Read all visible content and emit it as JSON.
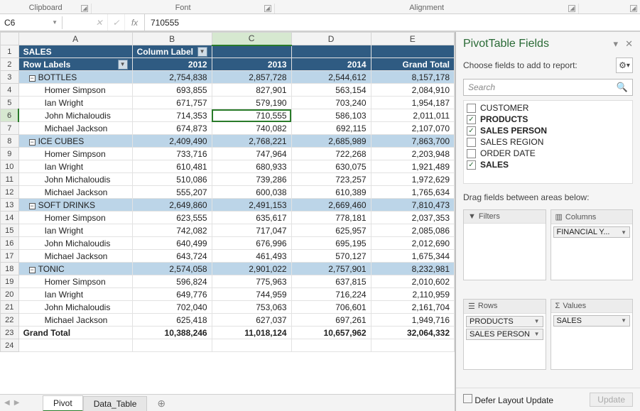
{
  "ribbon": {
    "groups": [
      "Clipboard",
      "Font",
      "Alignment",
      ""
    ]
  },
  "namebox": "C6",
  "formula": "710555",
  "columns": [
    "A",
    "B",
    "C",
    "D",
    "E"
  ],
  "active_col_idx": 2,
  "active_row": 6,
  "pivot": {
    "title_left": "SALES",
    "title_right": "Column Label",
    "row_labels": "Row Labels",
    "years": [
      "2012",
      "2013",
      "2014"
    ],
    "grand_total": "Grand Total"
  },
  "rows": [
    {
      "r": 3,
      "type": "cat",
      "label": "BOTTLES",
      "vals": [
        "2,754,838",
        "2,857,728",
        "2,544,612",
        "8,157,178"
      ]
    },
    {
      "r": 4,
      "type": "d",
      "label": "Homer Simpson",
      "vals": [
        "693,855",
        "827,901",
        "563,154",
        "2,084,910"
      ]
    },
    {
      "r": 5,
      "type": "d",
      "label": "Ian Wright",
      "vals": [
        "671,757",
        "579,190",
        "703,240",
        "1,954,187"
      ]
    },
    {
      "r": 6,
      "type": "d",
      "label": "John Michaloudis",
      "vals": [
        "714,353",
        "710,555",
        "586,103",
        "2,011,011"
      ]
    },
    {
      "r": 7,
      "type": "d",
      "label": "Michael Jackson",
      "vals": [
        "674,873",
        "740,082",
        "692,115",
        "2,107,070"
      ]
    },
    {
      "r": 8,
      "type": "cat",
      "label": "ICE CUBES",
      "vals": [
        "2,409,490",
        "2,768,221",
        "2,685,989",
        "7,863,700"
      ]
    },
    {
      "r": 9,
      "type": "d",
      "label": "Homer Simpson",
      "vals": [
        "733,716",
        "747,964",
        "722,268",
        "2,203,948"
      ]
    },
    {
      "r": 10,
      "type": "d",
      "label": "Ian Wright",
      "vals": [
        "610,481",
        "680,933",
        "630,075",
        "1,921,489"
      ]
    },
    {
      "r": 11,
      "type": "d",
      "label": "John Michaloudis",
      "vals": [
        "510,086",
        "739,286",
        "723,257",
        "1,972,629"
      ]
    },
    {
      "r": 12,
      "type": "d",
      "label": "Michael Jackson",
      "vals": [
        "555,207",
        "600,038",
        "610,389",
        "1,765,634"
      ]
    },
    {
      "r": 13,
      "type": "cat",
      "label": "SOFT DRINKS",
      "vals": [
        "2,649,860",
        "2,491,153",
        "2,669,460",
        "7,810,473"
      ]
    },
    {
      "r": 14,
      "type": "d",
      "label": "Homer Simpson",
      "vals": [
        "623,555",
        "635,617",
        "778,181",
        "2,037,353"
      ]
    },
    {
      "r": 15,
      "type": "d",
      "label": "Ian Wright",
      "vals": [
        "742,082",
        "717,047",
        "625,957",
        "2,085,086"
      ]
    },
    {
      "r": 16,
      "type": "d",
      "label": "John Michaloudis",
      "vals": [
        "640,499",
        "676,996",
        "695,195",
        "2,012,690"
      ]
    },
    {
      "r": 17,
      "type": "d",
      "label": "Michael Jackson",
      "vals": [
        "643,724",
        "461,493",
        "570,127",
        "1,675,344"
      ]
    },
    {
      "r": 18,
      "type": "cat",
      "label": "TONIC",
      "vals": [
        "2,574,058",
        "2,901,022",
        "2,757,901",
        "8,232,981"
      ]
    },
    {
      "r": 19,
      "type": "d",
      "label": "Homer Simpson",
      "vals": [
        "596,824",
        "775,963",
        "637,815",
        "2,010,602"
      ]
    },
    {
      "r": 20,
      "type": "d",
      "label": "Ian Wright",
      "vals": [
        "649,776",
        "744,959",
        "716,224",
        "2,110,959"
      ]
    },
    {
      "r": 21,
      "type": "d",
      "label": "John Michaloudis",
      "vals": [
        "702,040",
        "753,063",
        "706,601",
        "2,161,704"
      ]
    },
    {
      "r": 22,
      "type": "d",
      "label": "Michael Jackson",
      "vals": [
        "625,418",
        "627,037",
        "697,261",
        "1,949,716"
      ]
    }
  ],
  "grand": {
    "r": 23,
    "label": "Grand Total",
    "vals": [
      "10,388,246",
      "11,018,124",
      "10,657,962",
      "32,064,332"
    ]
  },
  "empty_row": 24,
  "tabs": {
    "active": "Pivot",
    "other": "Data_Table"
  },
  "pane": {
    "title": "PivotTable Fields",
    "subtitle": "Choose fields to add to report:",
    "search_placeholder": "Search",
    "fields": [
      {
        "name": "CUSTOMER",
        "checked": false
      },
      {
        "name": "PRODUCTS",
        "checked": true
      },
      {
        "name": "SALES PERSON",
        "checked": true
      },
      {
        "name": "SALES REGION",
        "checked": false
      },
      {
        "name": "ORDER DATE",
        "checked": false
      },
      {
        "name": "SALES",
        "checked": true
      }
    ],
    "dragnote": "Drag fields between areas below:",
    "areas": {
      "filters": {
        "label": "Filters",
        "items": []
      },
      "columns": {
        "label": "Columns",
        "items": [
          "FINANCIAL Y..."
        ]
      },
      "rows": {
        "label": "Rows",
        "items": [
          "PRODUCTS",
          "SALES PERSON"
        ]
      },
      "values": {
        "label": "Values",
        "items": [
          "SALES"
        ]
      }
    },
    "defer": "Defer Layout Update",
    "update": "Update"
  }
}
